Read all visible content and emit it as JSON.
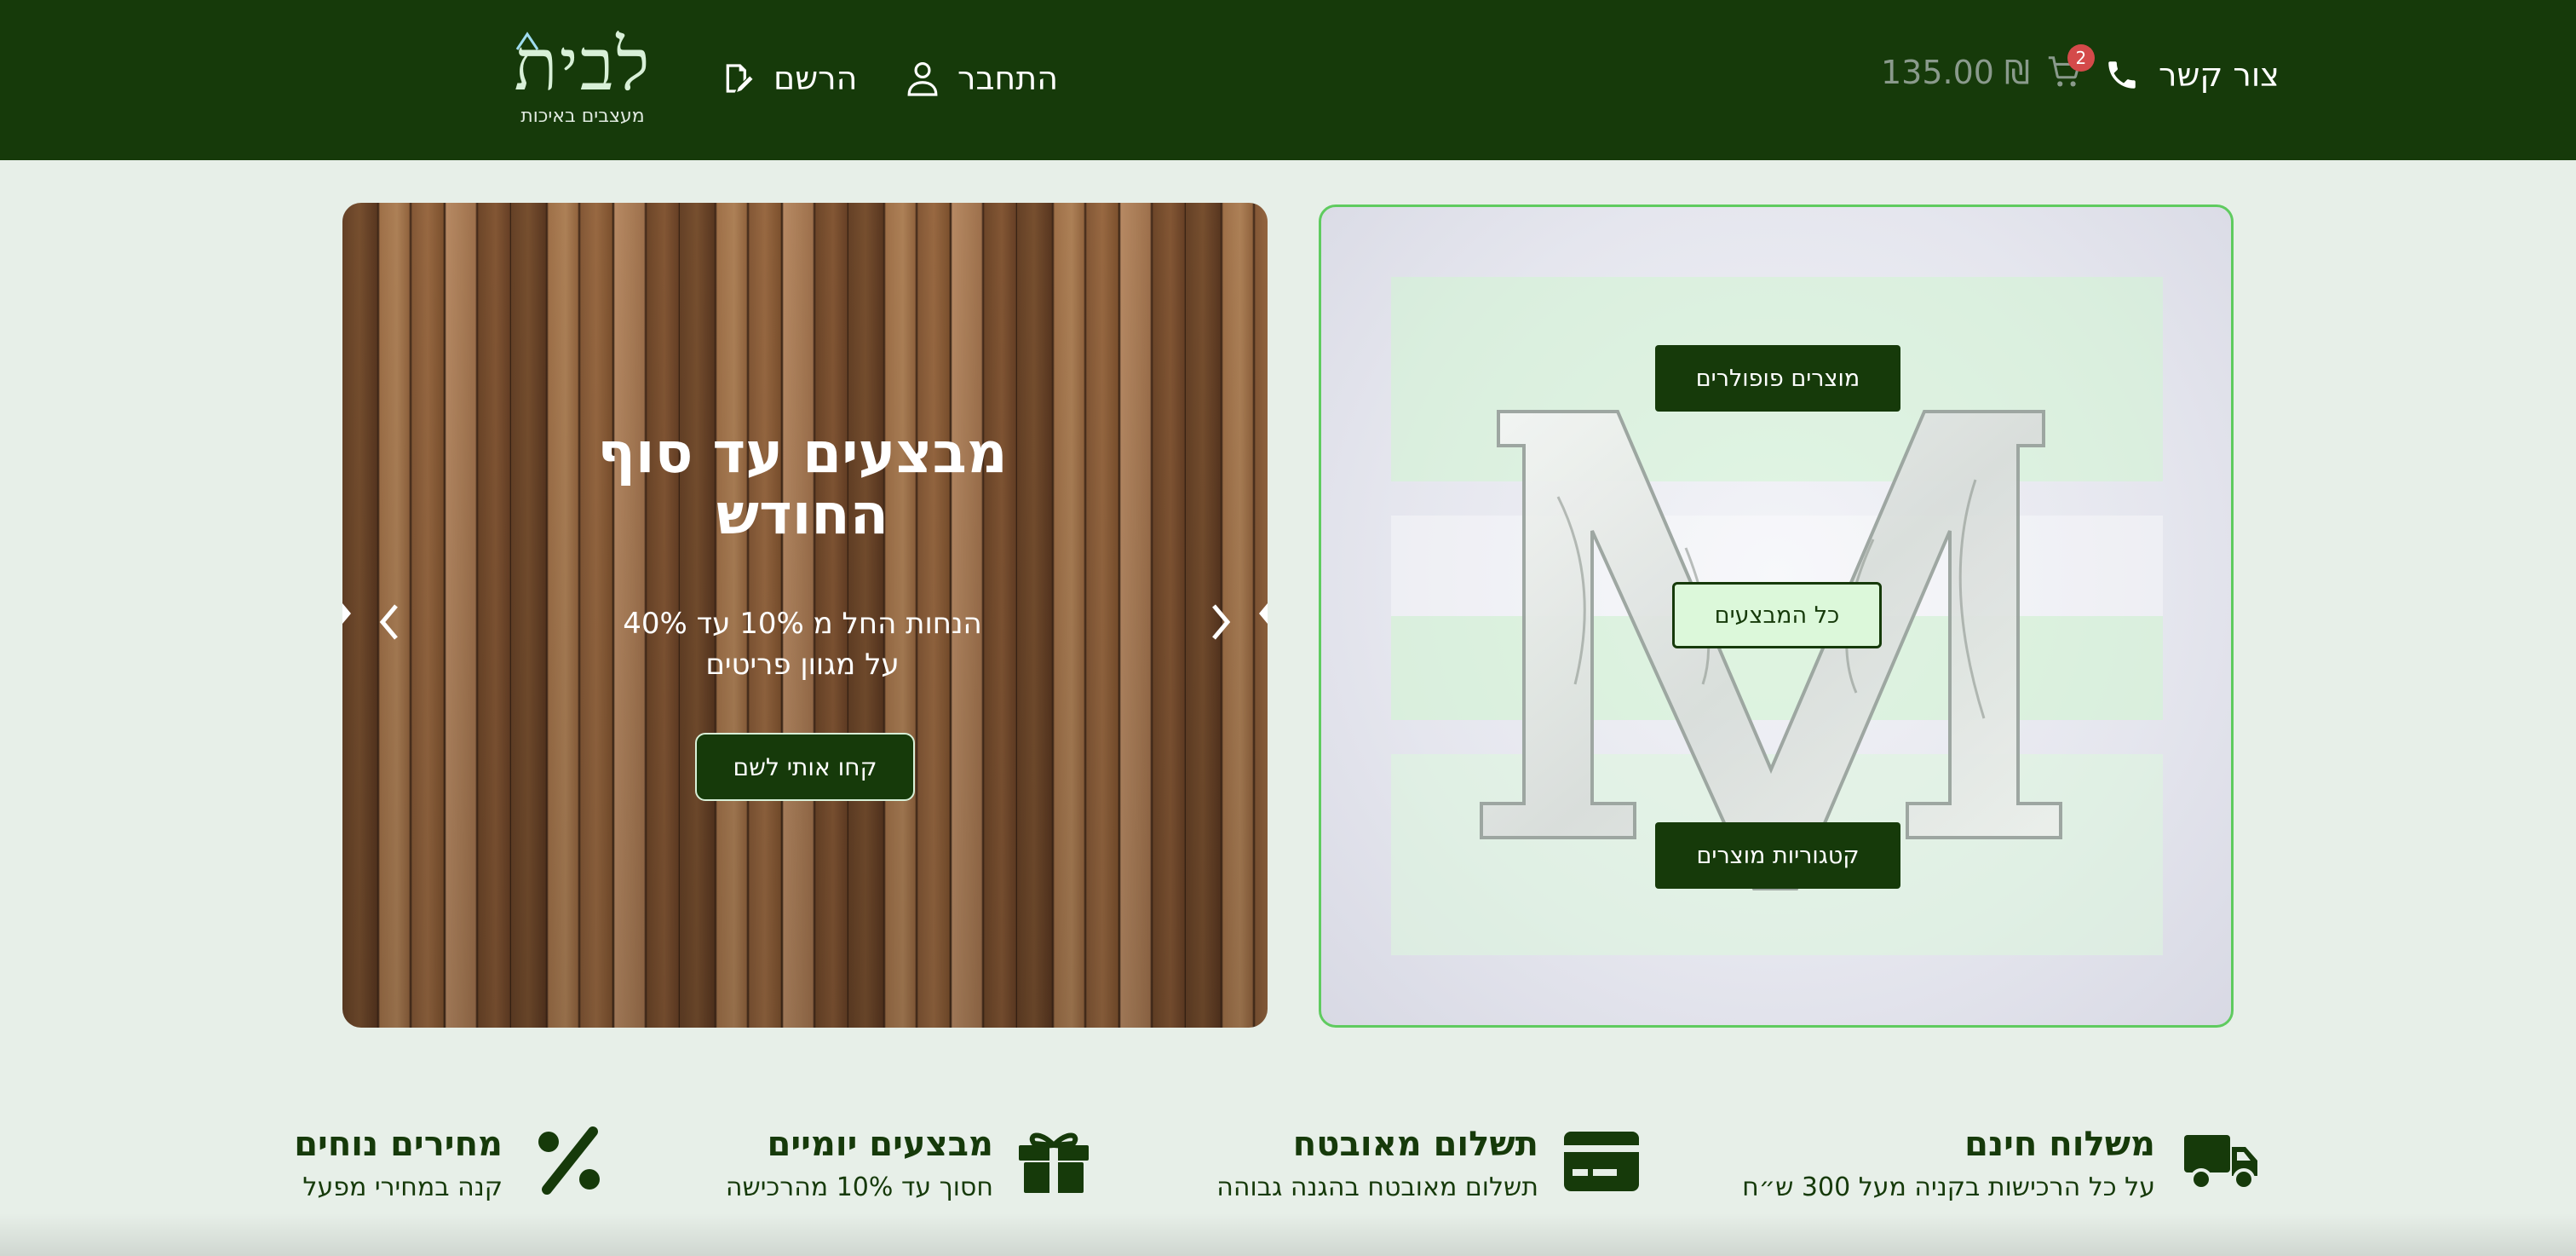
{
  "header": {
    "logo_text": "לבית",
    "logo_tagline": "מעצבים באיכות",
    "contact_label": "צור קשר",
    "cart_total": "135.00 ₪",
    "cart_count": "2",
    "login_label": "התחבר",
    "register_label": "הרשם"
  },
  "carousel": {
    "title": "מבצעים עד סוף החודש",
    "subtitle_line1": "הנחות החל מ 10% עד 40%",
    "subtitle_line2": "על מגוון פריטים",
    "cta_label": "קחו אותי לשם"
  },
  "marble_panel": {
    "popular_label": "מוצרים פופולרים",
    "all_deals_label": "כל המבצעים",
    "categories_label": "קטגוריות מוצרים"
  },
  "features": {
    "shipping": {
      "title": "משלוח חינם",
      "desc": "על כל הרכישות בקניה מעל 300 ש״ח",
      "icon": "truck-icon"
    },
    "payment": {
      "title": "תשלום מאובטח",
      "desc": "תשלום מאובטח בהגנה גבוהה",
      "icon": "credit-card-icon"
    },
    "deals": {
      "title": "מבצעים יומיים",
      "desc": "חסוך עד 10% מהרכישה",
      "icon": "gift-icon"
    },
    "prices": {
      "title": "מחירים נוחים",
      "desc": "קנה במחירי מפעל",
      "icon": "percent-icon"
    }
  },
  "colors": {
    "brand_dark": "#163a0a",
    "page_bg": "#e7efe8",
    "accent_light": "#dcf8da",
    "badge": "#d44a4a"
  }
}
